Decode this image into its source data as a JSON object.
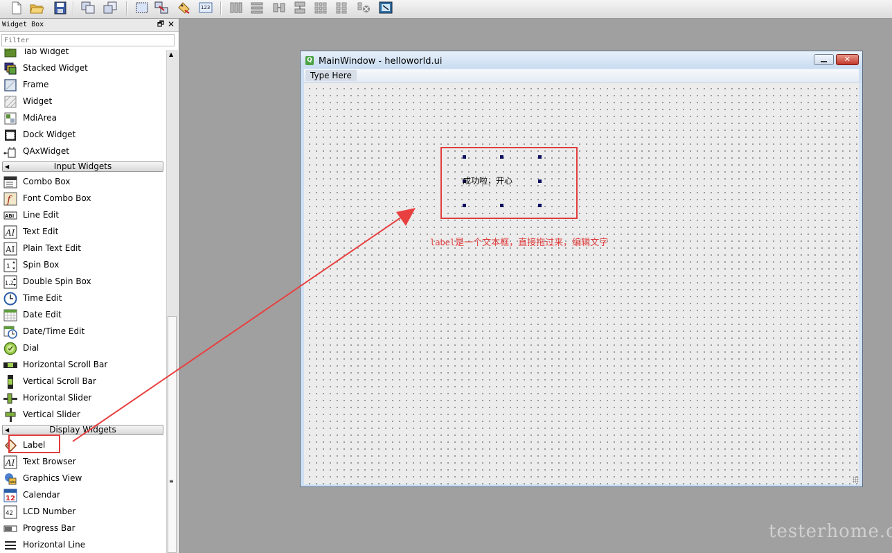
{
  "toolbar": {
    "buttons": [
      "new-file",
      "open-folder",
      "save",
      "bring-to-front",
      "send-to-back",
      "edit-widgets",
      "edit-signals-slots",
      "edit-buddies",
      "edit-tab-order",
      "layout-horizontal",
      "layout-vertical",
      "layout-h-splitter",
      "layout-v-splitter",
      "layout-grid",
      "layout-form",
      "break-layout",
      "adjust-size"
    ]
  },
  "widget_box": {
    "title": "Widget Box",
    "filter_placeholder": "Filter",
    "items_top": [
      {
        "label": "Tab Widget",
        "icon": "tab-widget-icon"
      },
      {
        "label": "Stacked Widget",
        "icon": "stacked-widget-icon"
      },
      {
        "label": "Frame",
        "icon": "frame-icon"
      },
      {
        "label": "Widget",
        "icon": "widget-icon"
      },
      {
        "label": "MdiArea",
        "icon": "mdi-area-icon"
      },
      {
        "label": "Dock Widget",
        "icon": "dock-widget-icon"
      },
      {
        "label": "QAxWidget",
        "icon": "qax-widget-icon"
      }
    ],
    "category_input": "Input Widgets",
    "items_input": [
      {
        "label": "Combo Box",
        "icon": "combo-box-icon"
      },
      {
        "label": "Font Combo Box",
        "icon": "font-combo-box-icon"
      },
      {
        "label": "Line Edit",
        "icon": "line-edit-icon"
      },
      {
        "label": "Text Edit",
        "icon": "text-edit-icon"
      },
      {
        "label": "Plain Text Edit",
        "icon": "plain-text-edit-icon"
      },
      {
        "label": "Spin Box",
        "icon": "spin-box-icon"
      },
      {
        "label": "Double Spin Box",
        "icon": "double-spin-box-icon"
      },
      {
        "label": "Time Edit",
        "icon": "time-edit-icon"
      },
      {
        "label": "Date Edit",
        "icon": "date-edit-icon"
      },
      {
        "label": "Date/Time Edit",
        "icon": "date-time-edit-icon"
      },
      {
        "label": "Dial",
        "icon": "dial-icon"
      },
      {
        "label": "Horizontal Scroll Bar",
        "icon": "horizontal-scroll-bar-icon"
      },
      {
        "label": "Vertical Scroll Bar",
        "icon": "vertical-scroll-bar-icon"
      },
      {
        "label": "Horizontal Slider",
        "icon": "horizontal-slider-icon"
      },
      {
        "label": "Vertical Slider",
        "icon": "vertical-slider-icon"
      }
    ],
    "category_display": "Display Widgets",
    "items_display": [
      {
        "label": "Label",
        "icon": "label-icon"
      },
      {
        "label": "Text Browser",
        "icon": "text-browser-icon"
      },
      {
        "label": "Graphics View",
        "icon": "graphics-view-icon"
      },
      {
        "label": "Calendar",
        "icon": "calendar-icon"
      },
      {
        "label": "LCD Number",
        "icon": "lcd-number-icon"
      },
      {
        "label": "Progress Bar",
        "icon": "progress-bar-icon"
      },
      {
        "label": "Horizontal Line",
        "icon": "horizontal-line-icon"
      }
    ]
  },
  "main_window": {
    "title": "MainWindow - helloworld.ui",
    "menu_placeholder": "Type Here",
    "label_text": "成功啦，开心",
    "close_glyph": "✕"
  },
  "annotation": {
    "code_word": "label",
    "text": "是一个文本框，直接拖过来，编辑文字",
    "color": "#e03c3c"
  },
  "watermark": "testerhome.com"
}
